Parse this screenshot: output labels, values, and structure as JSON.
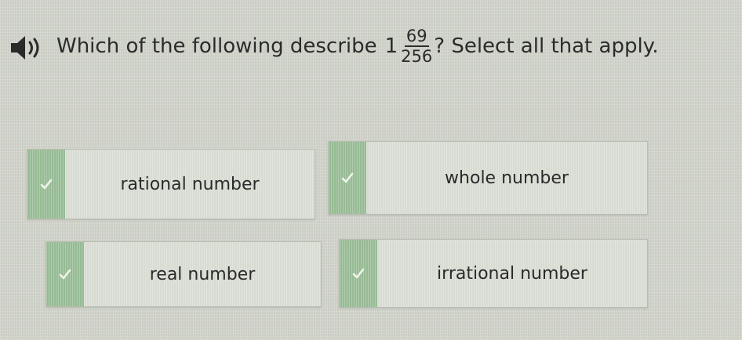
{
  "question": {
    "speaker_icon": "speaker-icon",
    "prefix": "Which of the following describe",
    "mixed_number": {
      "whole": "1",
      "numerator": "69",
      "denominator": "256"
    },
    "suffix": "? Select all that apply."
  },
  "options": [
    {
      "label": "rational number",
      "icon": "check-icon"
    },
    {
      "label": "whole number",
      "icon": "check-icon"
    },
    {
      "label": "real number",
      "icon": "check-icon"
    },
    {
      "label": "irrational number",
      "icon": "check-icon"
    }
  ],
  "colors": {
    "background": "#d3d6cd",
    "option_bar": "#9cc19a",
    "check": "#f1f4ec",
    "text": "#2b2b2b"
  }
}
